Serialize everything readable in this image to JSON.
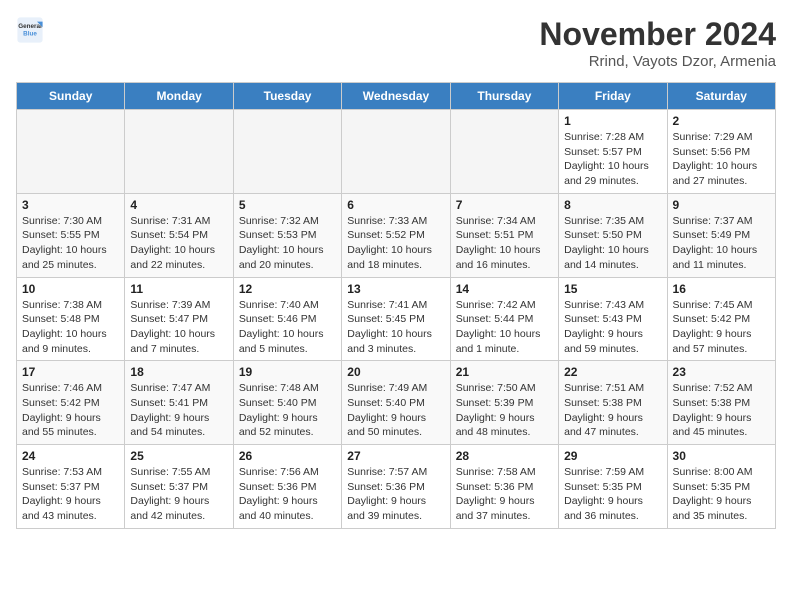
{
  "logo": {
    "line1": "General",
    "line2": "Blue"
  },
  "header": {
    "month": "November 2024",
    "location": "Rrind, Vayots Dzor, Armenia"
  },
  "weekdays": [
    "Sunday",
    "Monday",
    "Tuesday",
    "Wednesday",
    "Thursday",
    "Friday",
    "Saturday"
  ],
  "weeks": [
    [
      {
        "day": "",
        "info": ""
      },
      {
        "day": "",
        "info": ""
      },
      {
        "day": "",
        "info": ""
      },
      {
        "day": "",
        "info": ""
      },
      {
        "day": "",
        "info": ""
      },
      {
        "day": "1",
        "info": "Sunrise: 7:28 AM\nSunset: 5:57 PM\nDaylight: 10 hours and 29 minutes."
      },
      {
        "day": "2",
        "info": "Sunrise: 7:29 AM\nSunset: 5:56 PM\nDaylight: 10 hours and 27 minutes."
      }
    ],
    [
      {
        "day": "3",
        "info": "Sunrise: 7:30 AM\nSunset: 5:55 PM\nDaylight: 10 hours and 25 minutes."
      },
      {
        "day": "4",
        "info": "Sunrise: 7:31 AM\nSunset: 5:54 PM\nDaylight: 10 hours and 22 minutes."
      },
      {
        "day": "5",
        "info": "Sunrise: 7:32 AM\nSunset: 5:53 PM\nDaylight: 10 hours and 20 minutes."
      },
      {
        "day": "6",
        "info": "Sunrise: 7:33 AM\nSunset: 5:52 PM\nDaylight: 10 hours and 18 minutes."
      },
      {
        "day": "7",
        "info": "Sunrise: 7:34 AM\nSunset: 5:51 PM\nDaylight: 10 hours and 16 minutes."
      },
      {
        "day": "8",
        "info": "Sunrise: 7:35 AM\nSunset: 5:50 PM\nDaylight: 10 hours and 14 minutes."
      },
      {
        "day": "9",
        "info": "Sunrise: 7:37 AM\nSunset: 5:49 PM\nDaylight: 10 hours and 11 minutes."
      }
    ],
    [
      {
        "day": "10",
        "info": "Sunrise: 7:38 AM\nSunset: 5:48 PM\nDaylight: 10 hours and 9 minutes."
      },
      {
        "day": "11",
        "info": "Sunrise: 7:39 AM\nSunset: 5:47 PM\nDaylight: 10 hours and 7 minutes."
      },
      {
        "day": "12",
        "info": "Sunrise: 7:40 AM\nSunset: 5:46 PM\nDaylight: 10 hours and 5 minutes."
      },
      {
        "day": "13",
        "info": "Sunrise: 7:41 AM\nSunset: 5:45 PM\nDaylight: 10 hours and 3 minutes."
      },
      {
        "day": "14",
        "info": "Sunrise: 7:42 AM\nSunset: 5:44 PM\nDaylight: 10 hours and 1 minute."
      },
      {
        "day": "15",
        "info": "Sunrise: 7:43 AM\nSunset: 5:43 PM\nDaylight: 9 hours and 59 minutes."
      },
      {
        "day": "16",
        "info": "Sunrise: 7:45 AM\nSunset: 5:42 PM\nDaylight: 9 hours and 57 minutes."
      }
    ],
    [
      {
        "day": "17",
        "info": "Sunrise: 7:46 AM\nSunset: 5:42 PM\nDaylight: 9 hours and 55 minutes."
      },
      {
        "day": "18",
        "info": "Sunrise: 7:47 AM\nSunset: 5:41 PM\nDaylight: 9 hours and 54 minutes."
      },
      {
        "day": "19",
        "info": "Sunrise: 7:48 AM\nSunset: 5:40 PM\nDaylight: 9 hours and 52 minutes."
      },
      {
        "day": "20",
        "info": "Sunrise: 7:49 AM\nSunset: 5:40 PM\nDaylight: 9 hours and 50 minutes."
      },
      {
        "day": "21",
        "info": "Sunrise: 7:50 AM\nSunset: 5:39 PM\nDaylight: 9 hours and 48 minutes."
      },
      {
        "day": "22",
        "info": "Sunrise: 7:51 AM\nSunset: 5:38 PM\nDaylight: 9 hours and 47 minutes."
      },
      {
        "day": "23",
        "info": "Sunrise: 7:52 AM\nSunset: 5:38 PM\nDaylight: 9 hours and 45 minutes."
      }
    ],
    [
      {
        "day": "24",
        "info": "Sunrise: 7:53 AM\nSunset: 5:37 PM\nDaylight: 9 hours and 43 minutes."
      },
      {
        "day": "25",
        "info": "Sunrise: 7:55 AM\nSunset: 5:37 PM\nDaylight: 9 hours and 42 minutes."
      },
      {
        "day": "26",
        "info": "Sunrise: 7:56 AM\nSunset: 5:36 PM\nDaylight: 9 hours and 40 minutes."
      },
      {
        "day": "27",
        "info": "Sunrise: 7:57 AM\nSunset: 5:36 PM\nDaylight: 9 hours and 39 minutes."
      },
      {
        "day": "28",
        "info": "Sunrise: 7:58 AM\nSunset: 5:36 PM\nDaylight: 9 hours and 37 minutes."
      },
      {
        "day": "29",
        "info": "Sunrise: 7:59 AM\nSunset: 5:35 PM\nDaylight: 9 hours and 36 minutes."
      },
      {
        "day": "30",
        "info": "Sunrise: 8:00 AM\nSunset: 5:35 PM\nDaylight: 9 hours and 35 minutes."
      }
    ]
  ]
}
